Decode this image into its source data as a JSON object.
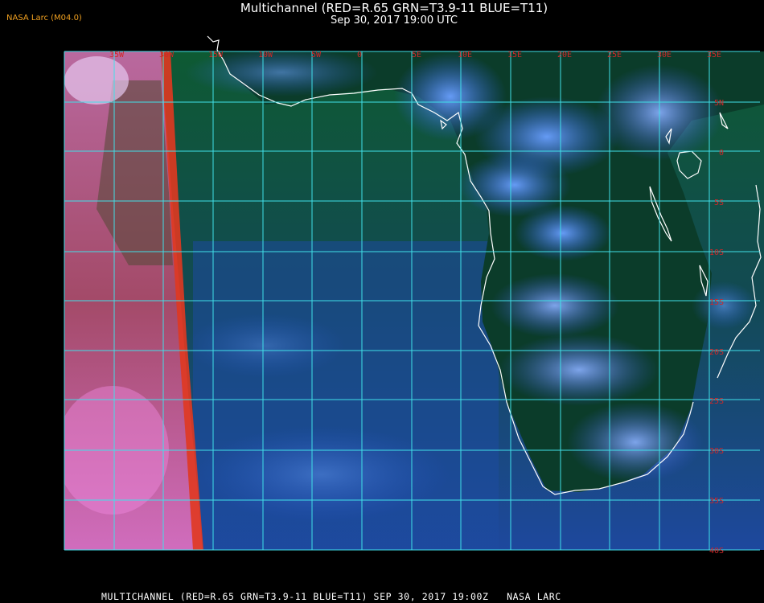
{
  "header": {
    "credit": "NASA Larc (M04.0)",
    "title": "Multichannel (RED=R.65 GRN=T3.9-11 BLUE=T11)",
    "subtitle": "Sep 30, 2017 19:00 UTC"
  },
  "map": {
    "lon_labels": [
      "35W",
      "30W",
      "15W",
      "10W",
      "5W",
      "0",
      "5E",
      "10E",
      "15E",
      "20E",
      "25E",
      "30E",
      "35E"
    ],
    "lat_labels": [
      "5N",
      "0",
      "5S",
      "10S",
      "15S",
      "20S",
      "25S",
      "30S",
      "35S",
      "40S"
    ],
    "colors": {
      "grid": "#40e0e8",
      "coast": "#ffffff",
      "labels": "#d02828",
      "ocean": "#0d4a3a",
      "land": "#0a3a28"
    }
  },
  "footer": {
    "text": "MULTICHANNEL (RED=R.65 GRN=T3.9-11 BLUE=T11) SEP 30, 2017 19:00Z   NASA LARC"
  }
}
